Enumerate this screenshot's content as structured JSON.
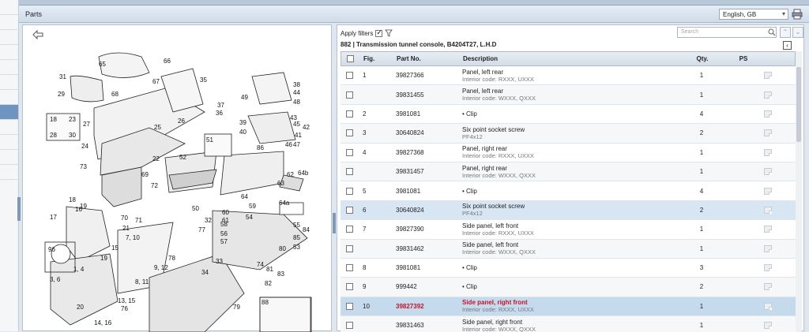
{
  "window": {
    "panel_title": "Parts",
    "language": "English, GB"
  },
  "filters": {
    "label": "Apply filters",
    "checked": true
  },
  "search": {
    "placeholder": "Search"
  },
  "breadcrumb": "882  |  Transmission tunnel console, B4204T27, L.H.D",
  "table": {
    "headers": {
      "fig": "Fig.",
      "part": "Part No.",
      "desc": "Description",
      "qty": "Qty.",
      "ps": "PS"
    },
    "rows": [
      {
        "fig": "1",
        "part": "39827366",
        "desc": "Panel, left rear",
        "sub": "Interior code: RXXX, UXXX",
        "qty": "1"
      },
      {
        "fig": "",
        "part": "39831455",
        "desc": "Panel, left rear",
        "sub": "Interior code: WXXX, QXXX",
        "qty": "1"
      },
      {
        "fig": "2",
        "part": "3981081",
        "desc": "• Clip",
        "sub": "",
        "qty": "4"
      },
      {
        "fig": "3",
        "part": "30640824",
        "desc": "Six point socket screw",
        "sub": "PF4x12",
        "qty": "2"
      },
      {
        "fig": "4",
        "part": "39827368",
        "desc": "Panel, right rear",
        "sub": "Interior code: RXXX, UXXX",
        "qty": "1"
      },
      {
        "fig": "",
        "part": "39831457",
        "desc": "Panel, right rear",
        "sub": "Interior code: WXXX, QXXX",
        "qty": "1"
      },
      {
        "fig": "5",
        "part": "3981081",
        "desc": "• Clip",
        "sub": "",
        "qty": "4"
      },
      {
        "fig": "6",
        "part": "30640824",
        "desc": "Six point socket screw",
        "sub": "PF4x12",
        "qty": "2"
      },
      {
        "fig": "7",
        "part": "39827390",
        "desc": "Side panel, left front",
        "sub": "Interior code: RXXX, UXXX",
        "qty": "1"
      },
      {
        "fig": "",
        "part": "39831462",
        "desc": "Side panel, left front",
        "sub": "Interior code: WXXX, QXXX",
        "qty": "1"
      },
      {
        "fig": "8",
        "part": "3981081",
        "desc": "• Clip",
        "sub": "",
        "qty": "3"
      },
      {
        "fig": "9",
        "part": "999442",
        "desc": "• Clip",
        "sub": "",
        "qty": "2"
      },
      {
        "fig": "10",
        "part": "39827392",
        "desc": "Side panel, right front",
        "sub": "Interior code: RXXX, UXXX",
        "qty": "1"
      },
      {
        "fig": "",
        "part": "39831463",
        "desc": "Side panel, right front",
        "sub": "Interior code: WXXX, QXXX",
        "qty": "1"
      }
    ]
  },
  "diagram_labels": [
    "65",
    "66",
    "31",
    "67",
    "35",
    "29",
    "68",
    "37",
    "36",
    "25",
    "26",
    "27",
    "18",
    "23",
    "28",
    "30",
    "24",
    "22",
    "52",
    "51",
    "73",
    "69",
    "72",
    "50",
    "19",
    "18",
    "16",
    "17",
    "21",
    "71",
    "70",
    "7, 10",
    "96",
    "19",
    "15",
    "1, 4",
    "3, 6",
    "8, 11",
    "9, 12",
    "13, 15",
    "76",
    "14, 16",
    "20",
    "78",
    "77",
    "34",
    "32",
    "33",
    "79",
    "88",
    "58",
    "56",
    "57",
    "60",
    "61",
    "59",
    "54",
    "55",
    "53",
    "80",
    "81",
    "82",
    "83",
    "74",
    "38",
    "44",
    "48",
    "49",
    "39",
    "43",
    "40",
    "45",
    "42",
    "41",
    "47",
    "46",
    "86",
    "64b",
    "62",
    "63",
    "64",
    "64a",
    "84",
    "85"
  ],
  "icons": {
    "back": "back-arrow-icon",
    "print": "printer-icon",
    "filter": "filter-icon",
    "search": "search-icon",
    "note": "note-icon"
  }
}
